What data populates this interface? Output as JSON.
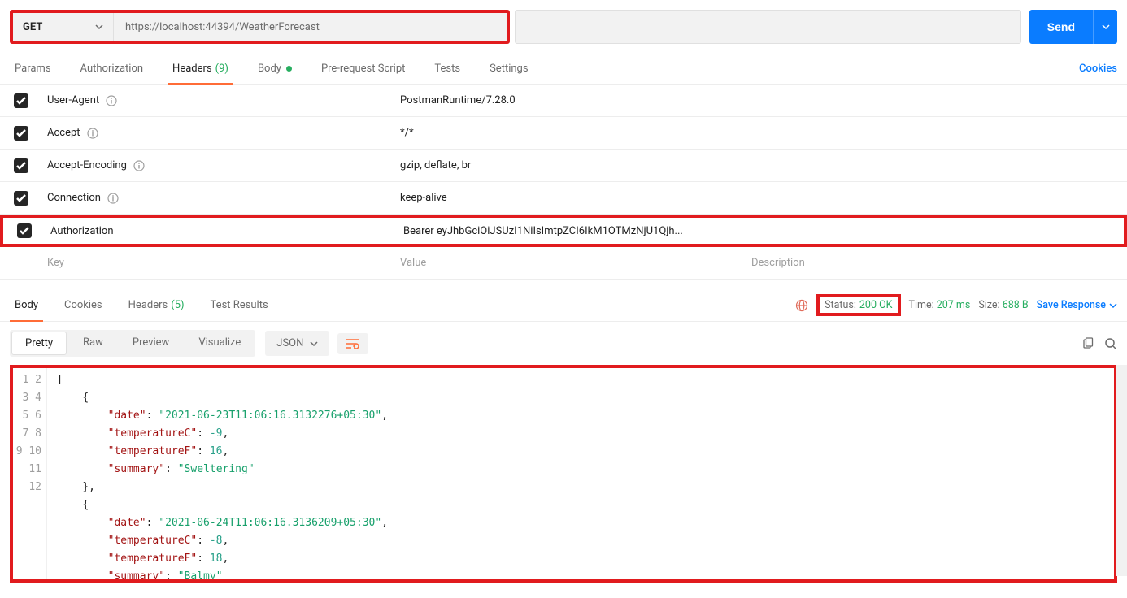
{
  "request": {
    "method": "GET",
    "url": "https://localhost:44394/WeatherForecast",
    "send_label": "Send"
  },
  "req_tabs": {
    "params": "Params",
    "authorization": "Authorization",
    "headers": "Headers",
    "headers_count": "(9)",
    "body": "Body",
    "prerequest": "Pre-request Script",
    "tests": "Tests",
    "settings": "Settings",
    "cookies": "Cookies"
  },
  "headers": [
    {
      "key": "User-Agent",
      "value": "PostmanRuntime/7.28.0",
      "info": true,
      "highlight": false
    },
    {
      "key": "Accept",
      "value": "*/*",
      "info": true,
      "highlight": false
    },
    {
      "key": "Accept-Encoding",
      "value": "gzip, deflate, br",
      "info": true,
      "highlight": false
    },
    {
      "key": "Connection",
      "value": "keep-alive",
      "info": true,
      "highlight": false
    },
    {
      "key": "Authorization",
      "value": "Bearer eyJhbGciOiJSUzI1NiIsImtpZCI6IkM1OTMzNjU1Qjh...",
      "info": false,
      "highlight": true
    }
  ],
  "header_placeholder": {
    "key": "Key",
    "value": "Value",
    "description": "Description"
  },
  "res_tabs": {
    "body": "Body",
    "cookies": "Cookies",
    "headers": "Headers",
    "headers_count": "(5)",
    "test_results": "Test Results"
  },
  "status": {
    "label": "Status:",
    "value": "200 OK"
  },
  "time": {
    "label": "Time:",
    "value": "207 ms"
  },
  "size": {
    "label": "Size:",
    "value": "688 B"
  },
  "save_response": "Save Response",
  "view_modes": {
    "pretty": "Pretty",
    "raw": "Raw",
    "preview": "Preview",
    "visualize": "Visualize",
    "format": "JSON"
  },
  "json_body": [
    {
      "date": "2021-06-23T11:06:16.3132276+05:30",
      "temperatureC": -9,
      "temperatureF": 16,
      "summary": "Sweltering"
    },
    {
      "date": "2021-06-24T11:06:16.3136209+05:30",
      "temperatureC": -8,
      "temperatureF": 18,
      "summary": "Balmy"
    }
  ],
  "line_count": 12
}
